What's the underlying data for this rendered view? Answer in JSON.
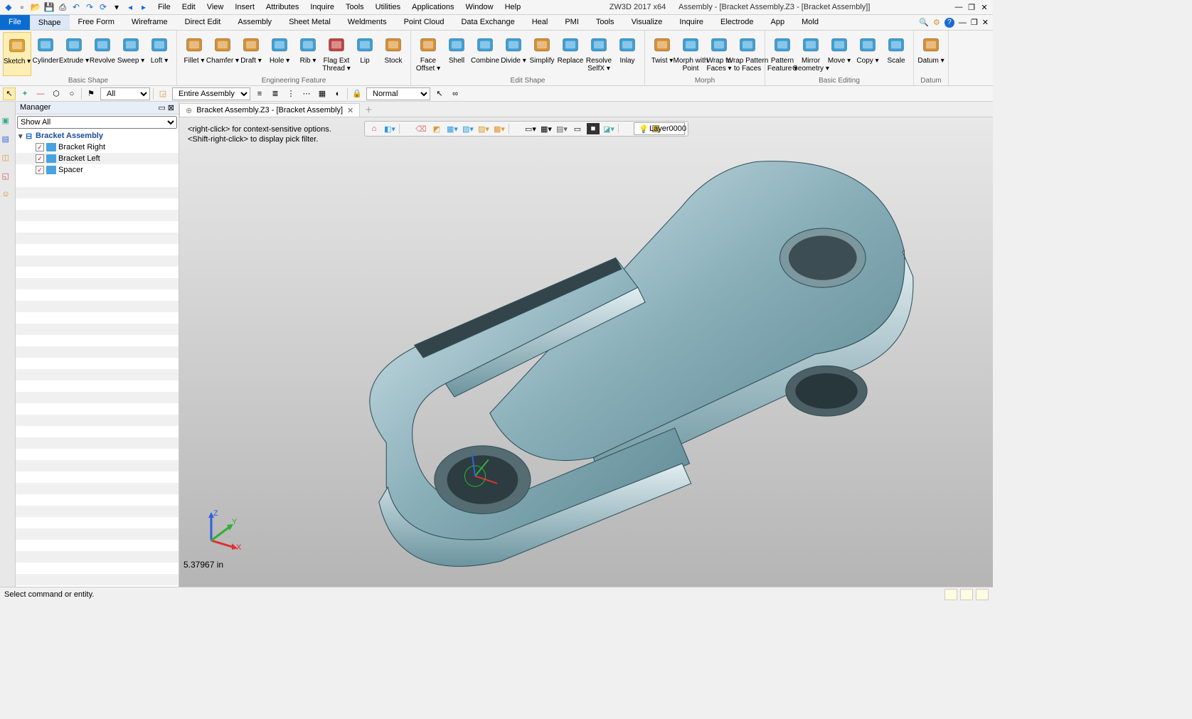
{
  "app": {
    "title_left": "ZW3D 2017  x64",
    "title_right": "Assembly - [Bracket Assembly.Z3 - [Bracket Assembly]]"
  },
  "menus": [
    "File",
    "Edit",
    "View",
    "Insert",
    "Attributes",
    "Inquire",
    "Tools",
    "Utilities",
    "Applications",
    "Window",
    "Help"
  ],
  "ribbon_tabs": [
    "Shape",
    "Free Form",
    "Wireframe",
    "Direct Edit",
    "Assembly",
    "Sheet Metal",
    "Weldments",
    "Point Cloud",
    "Data Exchange",
    "Heal",
    "PMI",
    "Tools",
    "Visualize",
    "Inquire",
    "Electrode",
    "App",
    "Mold"
  ],
  "file_tab": "File",
  "active_tab": "Shape",
  "ribbon_groups": [
    {
      "name": "Basic Shape",
      "buttons": [
        {
          "label": "Sketch",
          "drop": true,
          "color": "#e0a030"
        },
        {
          "label": "Cylinder",
          "color": "#3aa0d8"
        },
        {
          "label": "Extrude",
          "drop": true,
          "color": "#3aa0d8"
        },
        {
          "label": "Revolve",
          "color": "#3aa0d8"
        },
        {
          "label": "Sweep",
          "drop": true,
          "color": "#3aa0d8"
        },
        {
          "label": "Loft",
          "drop": true,
          "color": "#3aa0d8"
        }
      ]
    },
    {
      "name": "Engineering Feature",
      "buttons": [
        {
          "label": "Fillet",
          "drop": true,
          "color": "#d89030"
        },
        {
          "label": "Chamfer",
          "drop": true,
          "color": "#d89030"
        },
        {
          "label": "Draft",
          "drop": true,
          "color": "#d89030"
        },
        {
          "label": "Hole",
          "drop": true,
          "color": "#3aa0d8"
        },
        {
          "label": "Rib",
          "drop": true,
          "color": "#3aa0d8"
        },
        {
          "label": "Flag Ext\nThread",
          "drop": true,
          "color": "#c04040"
        },
        {
          "label": "Lip",
          "color": "#3aa0d8"
        },
        {
          "label": "Stock",
          "color": "#d89030"
        }
      ]
    },
    {
      "name": "Edit Shape",
      "buttons": [
        {
          "label": "Face\nOffset",
          "drop": true,
          "color": "#d89030"
        },
        {
          "label": "Shell",
          "color": "#3aa0d8"
        },
        {
          "label": "Combine",
          "color": "#3aa0d8"
        },
        {
          "label": "Divide",
          "drop": true,
          "color": "#3aa0d8"
        },
        {
          "label": "Simplify",
          "color": "#d89030"
        },
        {
          "label": "Replace",
          "color": "#3aa0d8"
        },
        {
          "label": "Resolve\nSelfX",
          "drop": true,
          "color": "#3aa0d8"
        },
        {
          "label": "Inlay",
          "color": "#3aa0d8"
        }
      ]
    },
    {
      "name": "Morph",
      "buttons": [
        {
          "label": "Twist",
          "drop": true,
          "color": "#d89030"
        },
        {
          "label": "Morph with\nPoint",
          "color": "#3aa0d8"
        },
        {
          "label": "Wrap to\nFaces",
          "drop": true,
          "color": "#3aa0d8"
        },
        {
          "label": "Wrap Pattern\nto Faces",
          "color": "#3aa0d8"
        }
      ]
    },
    {
      "name": "Basic Editing",
      "buttons": [
        {
          "label": "Pattern\nFeature",
          "drop": true,
          "color": "#3aa0d8"
        },
        {
          "label": "Mirror\nGeometry",
          "drop": true,
          "color": "#3aa0d8"
        },
        {
          "label": "Move",
          "drop": true,
          "color": "#3aa0d8"
        },
        {
          "label": "Copy",
          "drop": true,
          "color": "#3aa0d8"
        },
        {
          "label": "Scale",
          "color": "#3aa0d8"
        }
      ]
    },
    {
      "name": "Datum",
      "buttons": [
        {
          "label": "Datum",
          "drop": true,
          "color": "#d89030"
        }
      ]
    }
  ],
  "filter": {
    "all": "All",
    "scope": "Entire Assembly",
    "mode": "Normal"
  },
  "manager": {
    "title": "Manager",
    "show": "Show All",
    "root": "Bracket Assembly",
    "children": [
      "Bracket Right",
      "Bracket Left",
      "Spacer"
    ]
  },
  "doctab": "Bracket Assembly.Z3 - [Bracket Assembly]",
  "canvas": {
    "hint1": "<right-click> for context-sensitive options.",
    "hint2": "<Shift-right-click> to display pick filter.",
    "layer": "Layer0000",
    "dim": "5.37967 in",
    "axes": {
      "x": "X",
      "y": "Y",
      "z": "Z"
    }
  },
  "status": "Select command or entity."
}
